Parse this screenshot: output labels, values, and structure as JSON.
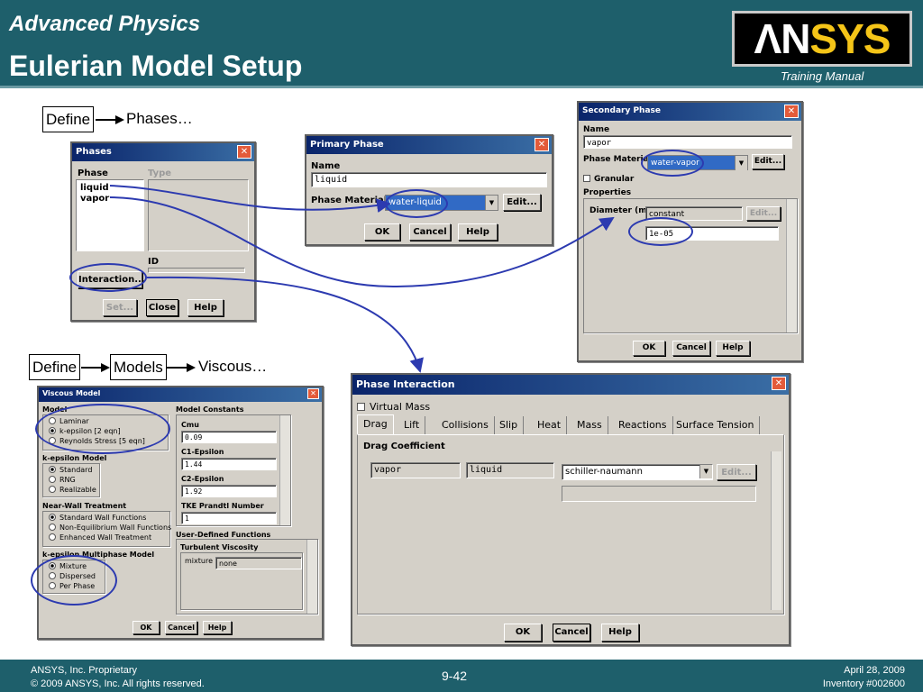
{
  "header": {
    "subtitle": "Advanced Physics",
    "title": "Eulerian Model Setup",
    "logo": "ANSYS",
    "tagline": "Training Manual"
  },
  "footer": {
    "line1": "ANSYS, Inc. Proprietary",
    "line2": "© 2009 ANSYS, Inc.  All rights reserved.",
    "page": "9-42",
    "date": "April 28, 2009",
    "inventory": "Inventory #002600"
  },
  "flow1": {
    "define": "Define",
    "target": "Phases…"
  },
  "flow2": {
    "define": "Define",
    "models": "Models",
    "target": "Viscous…"
  },
  "colors": {
    "header_bg": "#1e5f6b",
    "highlight_ring": "#2c3ab0",
    "titlebar": "#0a246a",
    "logo_accent": "#f5c518"
  },
  "phases": {
    "title": "Phases",
    "col_phase": "Phase",
    "col_type": "Type",
    "items": [
      "liquid",
      "vapor"
    ],
    "id_label": "ID",
    "interaction": "Interaction...",
    "set": "Set...",
    "close": "Close",
    "help": "Help"
  },
  "primary": {
    "title": "Primary Phase",
    "name_label": "Name",
    "name_value": "liquid",
    "material_label": "Phase Material",
    "material_value": "water-liquid",
    "edit": "Edit...",
    "ok": "OK",
    "cancel": "Cancel",
    "help": "Help"
  },
  "secondary": {
    "title": "Secondary Phase",
    "name_label": "Name",
    "name_value": "vapor",
    "material_label": "Phase Material",
    "material_value": "water-vapor",
    "edit": "Edit...",
    "granular": "Granular",
    "properties": "Properties",
    "diameter_label": "Diameter (m)",
    "diameter_method": "constant",
    "diameter_edit": "Edit...",
    "diameter_value": "1e-05",
    "ok": "OK",
    "cancel": "Cancel",
    "help": "Help"
  },
  "viscous": {
    "title": "Viscous Model",
    "model_label": "Model",
    "models": [
      "Laminar",
      "k-epsilon  [2 eqn]",
      "Reynolds Stress  [5 eqn]"
    ],
    "ke_label": "k-epsilon Model",
    "ke_models": [
      "Standard",
      "RNG",
      "Realizable"
    ],
    "wall_label": "Near-Wall Treatment",
    "wall_opts": [
      "Standard Wall Functions",
      "Non-Equilibrium Wall Functions",
      "Enhanced Wall Treatment"
    ],
    "mp_label": "k-epsilon Multiphase Model",
    "mp_opts": [
      "Mixture",
      "Dispersed",
      "Per Phase"
    ],
    "const_label": "Model Constants",
    "cmu_label": "Cmu",
    "cmu": "0.09",
    "c1_label": "C1-Epsilon",
    "c1": "1.44",
    "c2_label": "C2-Epsilon",
    "c2": "1.92",
    "tke_label": "TKE Prandtl Number",
    "tke": "1",
    "udf_label": "User-Defined Functions",
    "turb_label": "Turbulent Viscosity",
    "mixture_label": "mixture",
    "mixture_value": "none",
    "ok": "OK",
    "cancel": "Cancel",
    "help": "Help"
  },
  "interaction": {
    "title": "Phase Interaction",
    "virtual_mass": "Virtual Mass",
    "tabs": [
      "Drag",
      "Lift",
      "Collisions",
      "Slip",
      "Heat",
      "Mass",
      "Reactions",
      "Surface Tension"
    ],
    "drag_label": "Drag Coefficient",
    "phase1": "vapor",
    "phase2": "liquid",
    "method": "schiller-naumann",
    "edit": "Edit...",
    "ok": "OK",
    "cancel": "Cancel",
    "help": "Help"
  }
}
